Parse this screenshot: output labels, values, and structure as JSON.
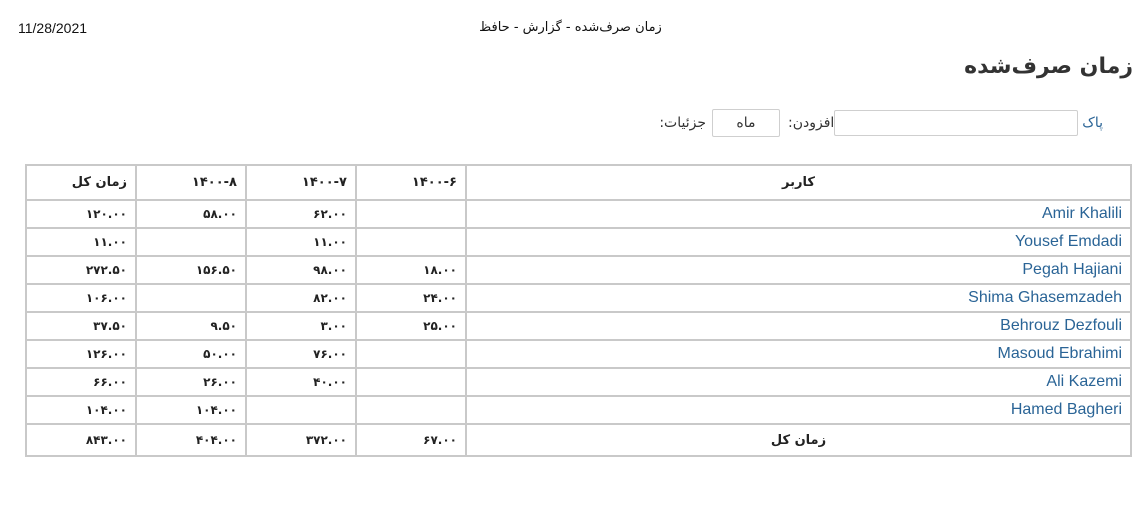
{
  "print_header": {
    "date": "11/28/2021",
    "title": "زمان صرف‌شده - گزارش - حافظ"
  },
  "page": {
    "title": "زمان صرف‌شده"
  },
  "query": {
    "details_label": "جزئیات:",
    "period_value": "ماه",
    "add_label": "افزودن:",
    "add_value": "",
    "clear_label": "پاک"
  },
  "table": {
    "headers": {
      "user": "کاربر",
      "p6": "۱۴۰۰-۶",
      "p7": "۱۴۰۰-۷",
      "p8": "۱۴۰۰-۸",
      "total": "زمان کل"
    },
    "rows": [
      {
        "user": "Amir Khalili",
        "p6": "",
        "p7": "۶۲.۰۰",
        "p8": "۵۸.۰۰",
        "total": "۱۲۰.۰۰"
      },
      {
        "user": "Yousef Emdadi",
        "p6": "",
        "p7": "۱۱.۰۰",
        "p8": "",
        "total": "۱۱.۰۰"
      },
      {
        "user": "Pegah Hajiani",
        "p6": "۱۸.۰۰",
        "p7": "۹۸.۰۰",
        "p8": "۱۵۶.۵۰",
        "total": "۲۷۲.۵۰"
      },
      {
        "user": "Shima Ghasemzadeh",
        "p6": "۲۴.۰۰",
        "p7": "۸۲.۰۰",
        "p8": "",
        "total": "۱۰۶.۰۰"
      },
      {
        "user": "Behrouz Dezfouli",
        "p6": "۲۵.۰۰",
        "p7": "۳.۰۰",
        "p8": "۹.۵۰",
        "total": "۳۷.۵۰"
      },
      {
        "user": "Masoud Ebrahimi",
        "p6": "",
        "p7": "۷۶.۰۰",
        "p8": "۵۰.۰۰",
        "total": "۱۲۶.۰۰"
      },
      {
        "user": "Ali Kazemi",
        "p6": "",
        "p7": "۴۰.۰۰",
        "p8": "۲۶.۰۰",
        "total": "۶۶.۰۰"
      },
      {
        "user": "Hamed Bagheri",
        "p6": "",
        "p7": "",
        "p8": "۱۰۴.۰۰",
        "total": "۱۰۴.۰۰"
      }
    ],
    "totals": {
      "label": "زمان کل",
      "p6": "۶۷.۰۰",
      "p7": "۳۷۲.۰۰",
      "p8": "۴۰۴.۰۰",
      "total": "۸۴۳.۰۰"
    }
  },
  "colors": {
    "link": "#2a6496",
    "border": "#c9c9c9"
  }
}
